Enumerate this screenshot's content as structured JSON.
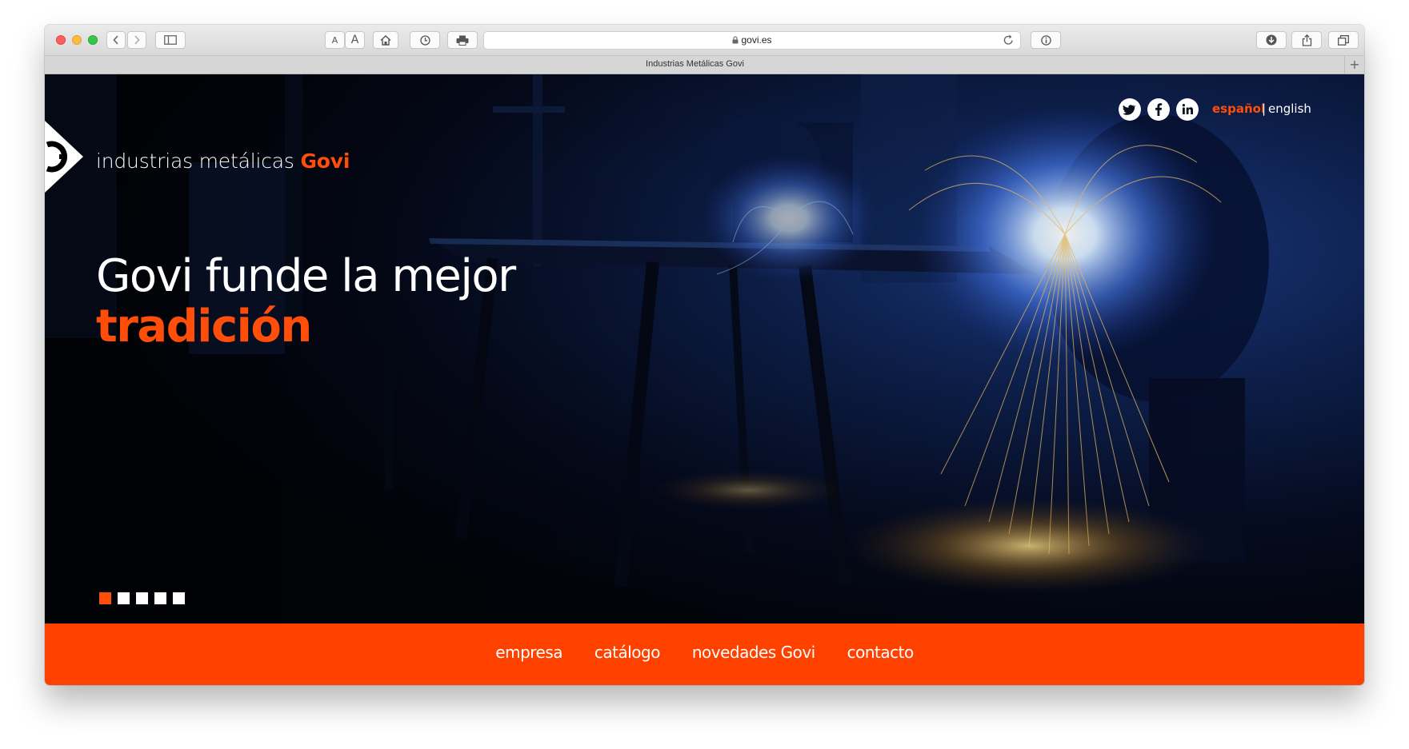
{
  "browser": {
    "url": "govi.es",
    "tab_title": "Industrias Metálicas Govi",
    "text_size_small": "A",
    "text_size_large": "A",
    "new_tab": "+"
  },
  "site": {
    "brand_prefix": "industrias metálicas ",
    "brand_name": "Govi",
    "headline_line1": "Govi funde la mejor",
    "headline_line2": "tradición",
    "languages": {
      "active": "español",
      "separator": "|",
      "other": "english"
    },
    "social": [
      "twitter-icon",
      "facebook-icon",
      "linkedin-icon"
    ],
    "slider": {
      "total": 5,
      "active": 1
    },
    "nav": [
      "empresa",
      "catálogo",
      "novedades Govi",
      "contacto"
    ]
  },
  "colors": {
    "accent": "#ff4d0a",
    "navbar": "#ff4100",
    "hero_dark": "#04060d"
  }
}
